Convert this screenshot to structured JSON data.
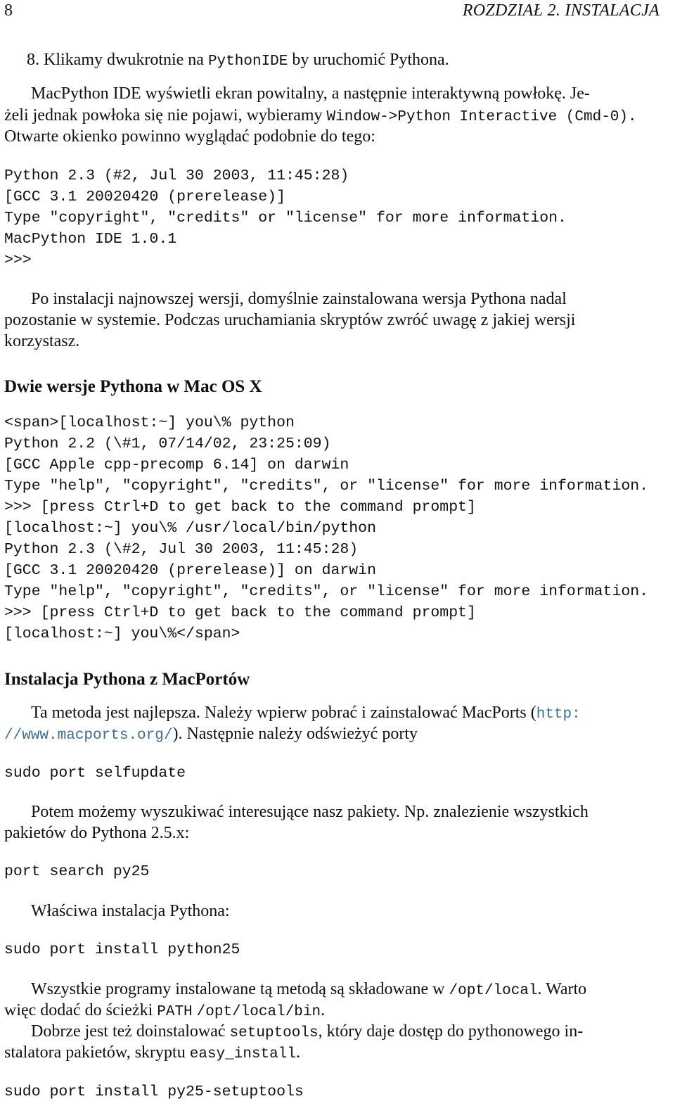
{
  "header": {
    "page_number": "8",
    "chapter_title": "ROZDZIAŁ 2.  INSTALACJA"
  },
  "step8": {
    "number": "8.",
    "before": "Klikamy dwukrotnie na ",
    "code": "PythonIDE",
    "after": " by uruchomić Pythona."
  },
  "para1": {
    "line1": "MacPython IDE wyświetli ekran powitalny, a następnie interaktywną powłokę. Je-",
    "line2_before": "żeli jednak powłoka się nie pojawi, wybieramy ",
    "line2_code": "Window->Python Interactive (Cmd-0).",
    "line3": "Otwarte okienko powinno wyglądać podobnie do tego:"
  },
  "code_block1": [
    "Python 2.3 (#2, Jul 30 2003, 11:45:28)",
    "[GCC 3.1 20020420 (prerelease)]",
    "Type \"copyright\", \"credits\" or \"license\" for more information.",
    "MacPython IDE 1.0.1",
    ">>>"
  ],
  "para2": {
    "line1": "Po instalacji najnowszej wersji, domyślnie zainstalowana wersja Pythona nadal",
    "line2": "pozostanie w systemie. Podczas uruchamiania skryptów zwróć uwagę z jakiej wersji",
    "line3": "korzystasz."
  },
  "section1": {
    "title": "Dwie wersje Pythona w Mac OS X"
  },
  "code_block2": [
    "<span>[localhost:~] you\\% python",
    "Python 2.2 (\\#1, 07/14/02, 23:25:09)",
    "[GCC Apple cpp-precomp 6.14] on darwin",
    "Type \"help\", \"copyright\", \"credits\", or \"license\" for more information.",
    ">>> [press Ctrl+D to get back to the command prompt]",
    "[localhost:~] you\\% /usr/local/bin/python",
    "Python 2.3 (\\#2, Jul 30 2003, 11:45:28)",
    "[GCC 3.1 20020420 (prerelease)] on darwin",
    "Type \"help\", \"copyright\", \"credits\", or \"license\" for more information.",
    ">>> [press Ctrl+D to get back to the command prompt]",
    "[localhost:~] you\\%</span>"
  ],
  "section2": {
    "title": "Instalacja Pythona z MacPortów"
  },
  "para3": {
    "line1_before": "Ta metoda jest najlepsza. Należy wpierw pobrać i zainstalować MacPorts (",
    "link_part1": "http:",
    "link_part2": "//www.macports.org/",
    "line2_after": "). Następnie należy odświeżyć porty"
  },
  "cmd1": "sudo port selfupdate",
  "para4": {
    "line1": "Potem możemy wyszukiwać interesujące nasz pakiety. Np. znalezienie wszystkich",
    "line2": "pakietów do Pythona 2.5.x:"
  },
  "cmd2": "port search py25",
  "para5": "Właściwa instalacja Pythona:",
  "cmd3": "sudo port install python25",
  "para6": {
    "line1_before": "Wszystkie programy instalowane tą metodą są składowane w ",
    "line1_code": "/opt/local",
    "line1_after": ". Warto",
    "line2_before": "więc dodać do ścieżki ",
    "line2_code1": "PATH",
    "line2_space": " ",
    "line2_code2": "/opt/local/bin",
    "line2_after": "."
  },
  "para7": {
    "line1_before": "Dobrze jest też doinstalować ",
    "line1_code": "setuptools",
    "line1_after": ", który daje dostęp do pythonowego in-",
    "line2_before": "stalatora pakietów, skryptu ",
    "line2_code": "easy_install",
    "line2_after": "."
  },
  "cmd4": "sudo port install py25-setuptools"
}
